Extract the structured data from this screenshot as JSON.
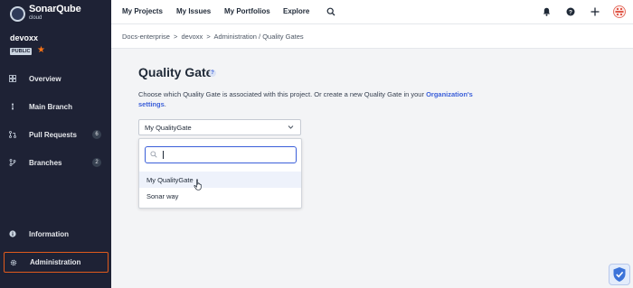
{
  "brand": {
    "name": "SonarQube",
    "sub": "cloud"
  },
  "project": {
    "name": "devoxx",
    "visibility": "PUBLIC"
  },
  "sidebar": {
    "items": [
      {
        "label": "Overview",
        "icon": "overview-icon"
      },
      {
        "label": "Main Branch",
        "icon": "branch-icon"
      },
      {
        "label": "Pull Requests",
        "icon": "pull-request-icon",
        "count": "6"
      },
      {
        "label": "Branches",
        "icon": "branches-icon",
        "count": "2"
      },
      {
        "label": "Information",
        "icon": "info-icon"
      },
      {
        "label": "Administration",
        "icon": "gear-icon"
      }
    ]
  },
  "topnav": {
    "items": [
      "My Projects",
      "My Issues",
      "My Portfolios",
      "Explore"
    ]
  },
  "breadcrumb": {
    "org": "Docs-enterprise",
    "sep": ">",
    "project": "devoxx",
    "page": "Administration / Quality Gates"
  },
  "main": {
    "title": "Quality Gate",
    "help": "?",
    "description": "Choose which Quality Gate is associated with this project. Or create a new Quality Gate in your ",
    "description_link": "Organization's settings",
    "description_end": "."
  },
  "select": {
    "value": "My QualityGate",
    "search_value": "",
    "options": [
      "My QualityGate",
      "Sonar way"
    ]
  },
  "colors": {
    "accent": "#3b5fd9",
    "sidebar": "#1e2235",
    "highlight": "#e05a1c"
  }
}
